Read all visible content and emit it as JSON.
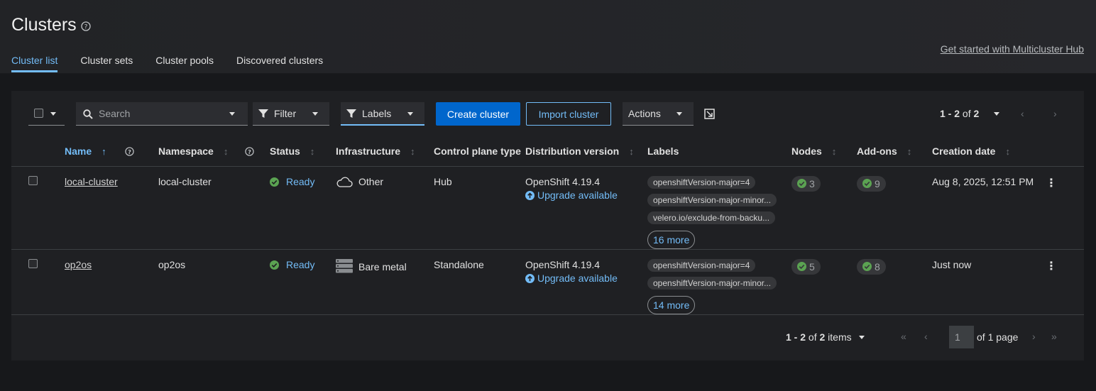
{
  "header": {
    "title": "Clusters",
    "tabs": [
      "Cluster list",
      "Cluster sets",
      "Cluster pools",
      "Discovered clusters"
    ],
    "get_started": "Get started with Multicluster Hub"
  },
  "toolbar": {
    "search_placeholder": "Search",
    "filter_label": "Filter",
    "labels_label": "Labels",
    "create_label": "Create cluster",
    "import_label": "Import cluster",
    "actions_label": "Actions",
    "pagination_range": "1 - 2",
    "pagination_of": "of",
    "pagination_total": "2"
  },
  "table": {
    "columns": [
      "Name",
      "Namespace",
      "Status",
      "Infrastructure",
      "Control plane type",
      "Distribution version",
      "Labels",
      "Nodes",
      "Add-ons",
      "Creation date"
    ],
    "rows": [
      {
        "name": "local-cluster",
        "namespace": "local-cluster",
        "status": "Ready",
        "infrastructure": "Other",
        "control_plane": "Hub",
        "distribution": "OpenShift 4.19.4",
        "upgrade": "Upgrade available",
        "labels": [
          "openshiftVersion-major=4",
          "openshiftVersion-major-minor...",
          "velero.io/exclude-from-backu..."
        ],
        "more_labels": "16 more",
        "nodes": "3",
        "addons": "9",
        "created": "Aug 8, 2025, 12:51 PM"
      },
      {
        "name": "op2os",
        "namespace": "op2os",
        "status": "Ready",
        "infrastructure": "Bare metal",
        "control_plane": "Standalone",
        "distribution": "OpenShift 4.19.4",
        "upgrade": "Upgrade available",
        "labels": [
          "openshiftVersion-major=4",
          "openshiftVersion-major-minor..."
        ],
        "more_labels": "14 more",
        "nodes": "5",
        "addons": "8",
        "created": "Just now"
      }
    ]
  },
  "pagination": {
    "range": "1 - 2",
    "of": "of",
    "total": "2",
    "items_suffix": "items",
    "page_value": "1",
    "of_page": "of 1 page"
  },
  "colors": {
    "accent": "#73bcf7",
    "primary_button": "#0066cc",
    "success": "#5ba352"
  }
}
